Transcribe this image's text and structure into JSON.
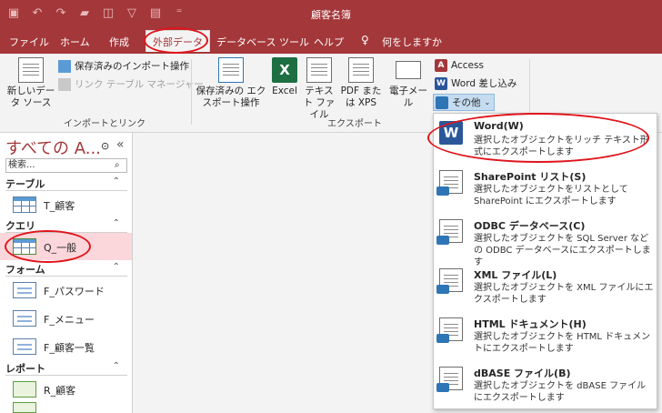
{
  "window": {
    "title": "顧客名簿"
  },
  "tabs": {
    "file": "ファイル",
    "home": "ホーム",
    "create": "作成",
    "external": "外部データ",
    "dbtools": "データベース ツール",
    "help": "ヘルプ",
    "tellme": "何をしますか"
  },
  "ribbon": {
    "import": {
      "new_source": "新しいデータ ソース",
      "saved_imports": "保存済みのインポート操作",
      "linked_table_manager": "リンク テーブル マネージャー",
      "group_label": "インポートとリンク"
    },
    "export": {
      "saved_exports": "保存済みの エクスポート操作",
      "excel": "Excel",
      "text_file": "テキスト ファイル",
      "pdf_xps": "PDF または XPS",
      "email": "電子メール",
      "access": "Access",
      "word_merge": "Word 差し込み",
      "more": "その他",
      "group_label": "エクスポート"
    }
  },
  "nav": {
    "header": "すべての A...",
    "search_placeholder": "検索...",
    "groups": [
      {
        "label": "テーブル",
        "items": [
          "T_顧客"
        ]
      },
      {
        "label": "クエリ",
        "items": [
          "Q_一般"
        ]
      },
      {
        "label": "フォーム",
        "items": [
          "F_パスワード",
          "F_メニュー",
          "F_顧客一覧"
        ]
      },
      {
        "label": "レポート",
        "items": [
          "R_顧客"
        ]
      }
    ]
  },
  "dropdown": {
    "items": [
      {
        "title": "Word(W)",
        "desc": "選択したオブジェクトをリッチ テキスト形式にエクスポートします"
      },
      {
        "title": "SharePoint リスト(S)",
        "desc": "選択したオブジェクトをリストとして SharePoint にエクスポートします"
      },
      {
        "title": "ODBC データベース(C)",
        "desc": "選択したオブジェクトを SQL Server などの ODBC データベースにエクスポートします"
      },
      {
        "title": "XML ファイル(L)",
        "desc": "選択したオブジェクトを XML ファイルにエクスポートします"
      },
      {
        "title": "HTML ドキュメント(H)",
        "desc": "選択したオブジェクトを HTML ドキュメントにエクスポートします"
      },
      {
        "title": "dBASE ファイル(B)",
        "desc": "選択したオブジェクトを dBASE ファイルにエクスポートします"
      }
    ]
  },
  "colors": {
    "accent": "#a4373a",
    "highlight": "#e0151c",
    "selected_row": "#fbd7db"
  }
}
